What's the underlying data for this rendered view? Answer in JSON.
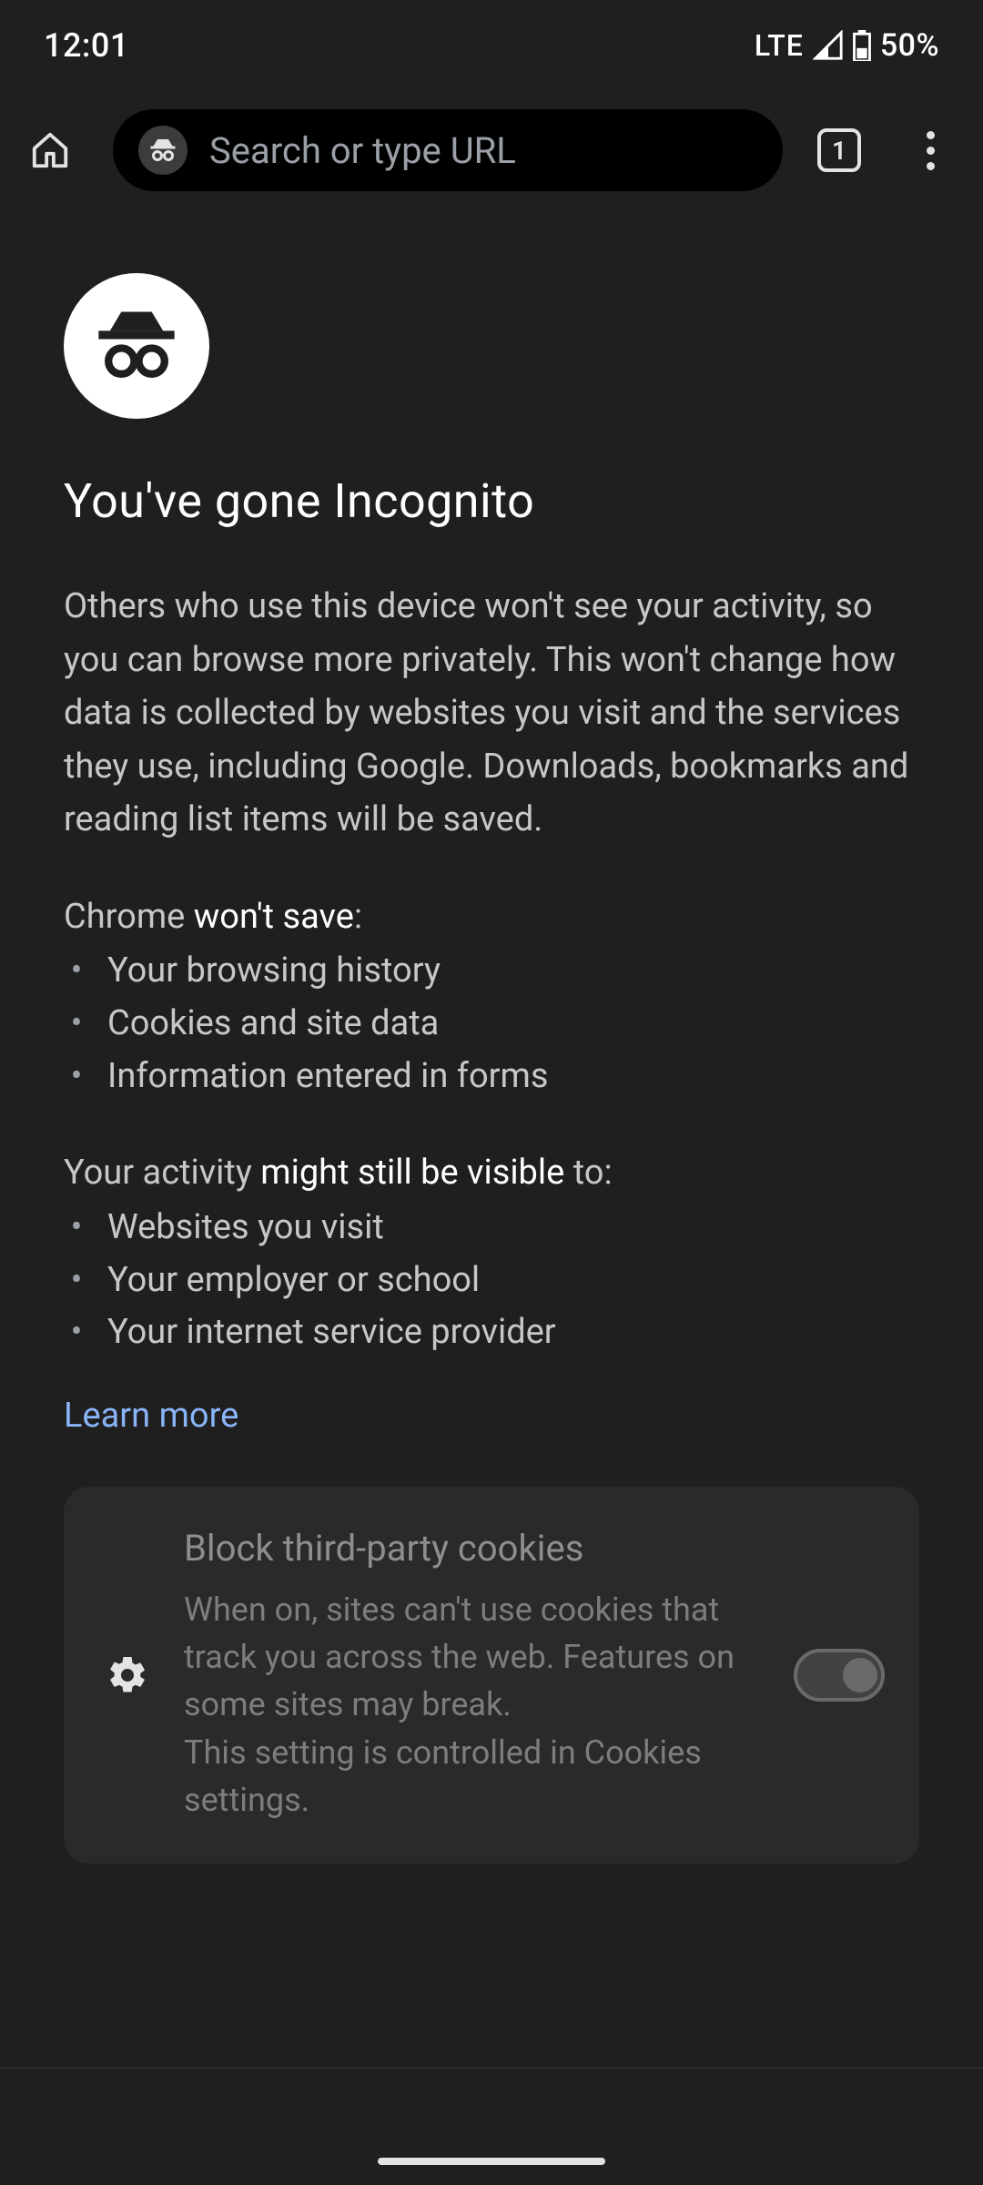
{
  "status": {
    "time": "12:01",
    "network": "LTE",
    "battery_pct": "50%"
  },
  "toolbar": {
    "omnibox_placeholder": "Search or type URL",
    "tab_count": "1"
  },
  "page": {
    "title": "You've gone Incognito",
    "intro": "Others who use this device won't see your activity, so you can browse more privately. This won't change how data is collected by websites you visit and the services they use, including Google. Downloads, bookmarks and reading list items will be saved.",
    "wont_save": {
      "prefix": "Chrome ",
      "emphasis": "won't save",
      "suffix": ":",
      "items": [
        "Your browsing history",
        "Cookies and site data",
        "Information entered in forms"
      ]
    },
    "might_visible": {
      "prefix": "Your activity ",
      "emphasis": "might still be visible",
      "suffix": " to:",
      "items": [
        "Websites you visit",
        "Your employer or school",
        "Your internet service provider"
      ]
    },
    "learn_more": "Learn more"
  },
  "cookie_card": {
    "title": "Block third-party cookies",
    "desc_line1": "When on, sites can't use cookies that track you across the web. Features on some sites may break.",
    "desc_line2": "This setting is controlled in Cookies settings.",
    "toggle_on": false
  }
}
